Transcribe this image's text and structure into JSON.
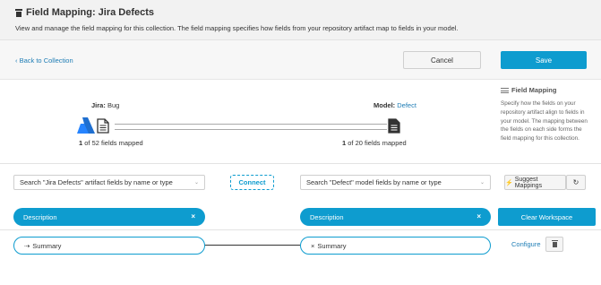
{
  "header": {
    "title": "Field Mapping: Jira Defects",
    "description": "View and manage the field mapping for this collection. The field mapping specifies how fields from your repository artifact map to fields in your model."
  },
  "toolbar": {
    "back_label": "Back to Collection",
    "cancel_label": "Cancel",
    "save_label": "Save"
  },
  "diagram": {
    "source_repo": "Jira:",
    "source_type": "Bug",
    "source_mapped": "1",
    "source_total_text": "of 52 fields mapped",
    "target_repo": "Model:",
    "target_type": "Defect",
    "target_mapped": "1",
    "target_total_text": "of 20 fields mapped"
  },
  "help": {
    "title": "Field Mapping",
    "text": "Specify how the fields on your repository artifact align to fields in your model. The mapping between the fields on each side forms the field mapping for this collection."
  },
  "workspace": {
    "source_search_placeholder": "Search \"Jira Defects\" artifact fields by name or type",
    "connect_label": "Connect",
    "target_search_placeholder": "Search \"Defect\" model fields by name or type",
    "suggest_label": "Suggest Mappings",
    "source_selected": "Description",
    "target_selected": "Description",
    "clear_label": "Clear Workspace"
  },
  "mappings": [
    {
      "source_field": "Summary",
      "target_field": "Summary",
      "configure_label": "Configure"
    }
  ],
  "colors": {
    "accent": "#0e9ccf",
    "link": "#1e7db5",
    "jira_blue": "#2684ff"
  }
}
